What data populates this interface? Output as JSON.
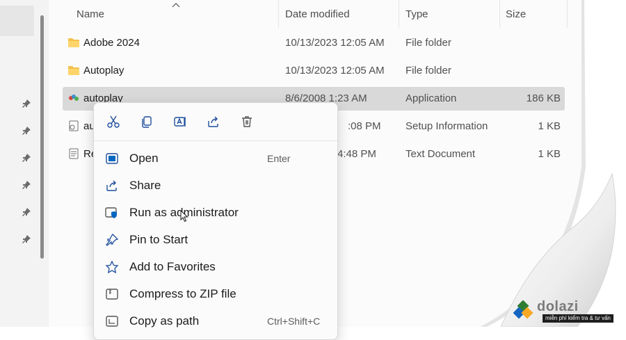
{
  "columns": {
    "name": "Name",
    "date": "Date modified",
    "type": "Type",
    "size": "Size"
  },
  "files": [
    {
      "name": "Adobe 2024",
      "date": "10/13/2023 12:05 AM",
      "type": "File folder",
      "size": "",
      "icon": "folder-icon",
      "selected": false
    },
    {
      "name": "Autoplay",
      "date": "10/13/2023 12:05 AM",
      "type": "File folder",
      "size": "",
      "icon": "folder-icon",
      "selected": false
    },
    {
      "name": "autoplay",
      "date": "8/6/2008 1:23 AM",
      "type": "Application",
      "size": "186 KB",
      "icon": "application-icon",
      "selected": true
    },
    {
      "name": "au",
      "date": ":08 PM",
      "type": "Setup Information",
      "size": "1 KB",
      "icon": "setup-file-icon",
      "selected": false
    },
    {
      "name": "Re",
      "date": "4:48 PM",
      "type": "Text Document",
      "size": "1 KB",
      "icon": "text-document-icon",
      "selected": false
    }
  ],
  "context_menu": {
    "quick_actions": [
      "cut-icon",
      "copy-icon",
      "rename-icon",
      "share-icon",
      "delete-icon"
    ],
    "items": [
      {
        "label": "Open",
        "shortcut": "Enter",
        "icon": "open-icon"
      },
      {
        "label": "Share",
        "shortcut": "",
        "icon": "share-icon"
      },
      {
        "label": "Run as administrator",
        "shortcut": "",
        "icon": "shield-icon"
      },
      {
        "label": "Pin to Start",
        "shortcut": "",
        "icon": "pin-icon"
      },
      {
        "label": "Add to Favorites",
        "shortcut": "",
        "icon": "star-icon"
      },
      {
        "label": "Compress to ZIP file",
        "shortcut": "",
        "icon": "zip-icon"
      },
      {
        "label": "Copy as path",
        "shortcut": "Ctrl+Shift+C",
        "icon": "copy-path-icon"
      }
    ]
  },
  "watermark": {
    "brand": "dolazi",
    "tagline": "miễn phí kiểm tra & tư vấn"
  },
  "colors": {
    "folder": "#f2c14e",
    "accent": "#0067c0",
    "selection": "#d9d9d9"
  }
}
